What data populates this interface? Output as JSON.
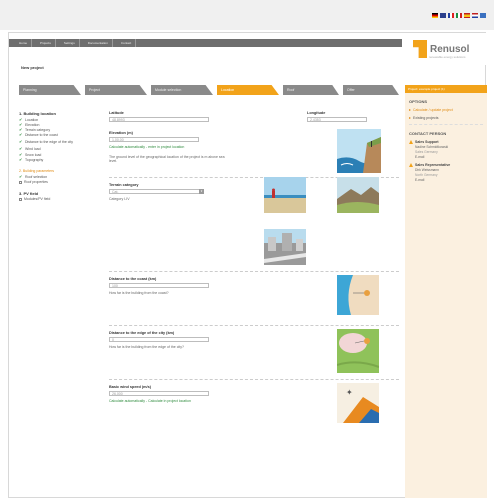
{
  "header": {
    "topnav": [
      "Home",
      "Projects",
      "Settings",
      "Documentation",
      "Contact"
    ],
    "logo": "Renusol",
    "logo_sub": "renewable energy solutions"
  },
  "page_title": "New project",
  "tabs": [
    {
      "label": "Planning",
      "active": false
    },
    {
      "label": "Project",
      "active": false
    },
    {
      "label": "Module selection",
      "active": false
    },
    {
      "label": "Location",
      "active": true
    },
    {
      "label": "Roof",
      "active": false
    },
    {
      "label": "Offer",
      "active": false
    }
  ],
  "leftnav": {
    "s1_title": "1. Building location",
    "s1_items": [
      "Location",
      "Elevation",
      "Terrain category",
      "Distance to the coast",
      "Distance to the edge of the city",
      "Wind load",
      "Snow load",
      "Topography"
    ],
    "s2_title": "2. Building parameters",
    "s2_items": [
      "Roof selection",
      "Roof properties"
    ],
    "s3_title": "3. PV field",
    "s3_items": [
      "Modules/PV field"
    ]
  },
  "content": {
    "latitude_label": "Latitude",
    "latitude_value": "48,8993",
    "longitude_label": "Longitude",
    "longitude_value": "2,4353",
    "elevation_label": "Elevation (m)",
    "elevation_value": "1,00,00",
    "elevation_note_link": "Calculate automatically - enter in project location",
    "elevation_note": "The ground level of the geographical location of the project is m above sea level.",
    "terrain_label": "Terrain category",
    "terrain_value": "Cat.",
    "terrain_note": "Category I-IV",
    "coast_label": "Distance to the coast (km)",
    "coast_value": "100",
    "coast_note": "How far is the building from the coast?",
    "city_label": "Distance to the edge of the city (km)",
    "city_value": "0",
    "city_note": "How far is the building from the edge of the city?",
    "wind_label": "Basic wind speed (m/s)",
    "wind_value": "26,000",
    "wind_note": "Calculate automatically - Calculate in project location"
  },
  "sidebar": {
    "orange_bar": "Project: example project (1)",
    "options_title": "OPTIONS",
    "options": [
      {
        "label": "Calculate / update project",
        "orange": true
      },
      {
        "label": "Existing projects",
        "orange": false
      }
    ],
    "contact_title": "CONTACT PERSON",
    "persons": [
      {
        "title": "Sales Support",
        "lines": [
          "Nadine Schmidtkowski",
          "Sales Germany",
          "E-mail"
        ]
      },
      {
        "title": "Sales Representative",
        "lines": [
          "Dirk Weissmann",
          "North Germany",
          "E-mail"
        ]
      }
    ]
  },
  "colors": {
    "accent": "#f2a31a",
    "nav": "#6e6e6e",
    "check": "#2e8b3d",
    "sidebar_bg": "#fbf0e0"
  }
}
